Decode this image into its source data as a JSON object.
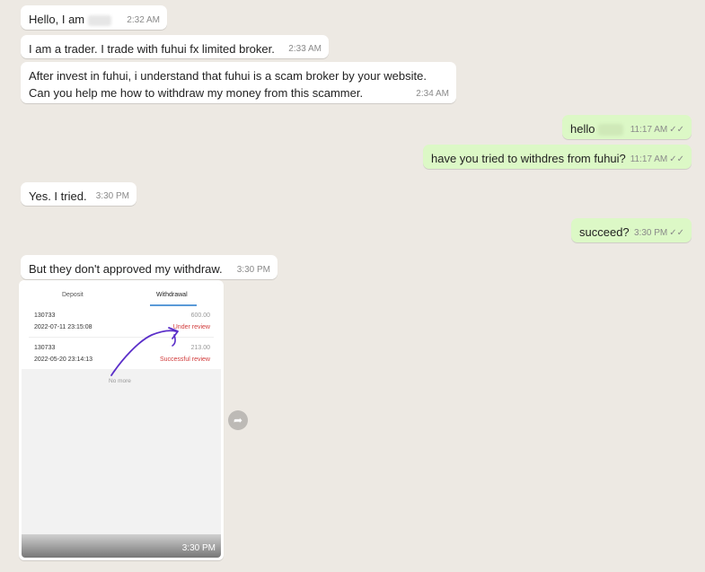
{
  "messages": [
    {
      "id": "m1",
      "text": "Hello, I am",
      "time": "2:32 AM"
    },
    {
      "id": "m2",
      "text": "I am a trader. I trade with  fuhui fx limited broker.",
      "time": "2:33 AM"
    },
    {
      "id": "m3",
      "text": "After invest in fuhui, i understand that fuhui is a scam broker by your website. Can you help me how to withdraw my money from this scammer.",
      "time": "2:34 AM"
    },
    {
      "id": "m4",
      "text": "hello",
      "time": "11:17 AM"
    },
    {
      "id": "m5",
      "text": "have you tried to withdres from fuhui?",
      "time": "11:17 AM"
    },
    {
      "id": "m6",
      "text": "Yes. I tried.",
      "time": "3:30 PM"
    },
    {
      "id": "m7",
      "text": "succeed?",
      "time": "3:30 PM"
    },
    {
      "id": "m8",
      "text": "But they don't approved my withdraw.",
      "time": "3:30 PM"
    }
  ],
  "image_message": {
    "time": "3:30 PM",
    "tabs": [
      "Deposit",
      "Withdrawal"
    ],
    "rows": [
      {
        "id": "130733",
        "date": "2022-07-11 23:15:08",
        "amount": "600.00",
        "status": "Under review"
      },
      {
        "id": "130733",
        "date": "2022-05-20 23:14:13",
        "amount": "213.00",
        "status": "Successful review"
      }
    ],
    "footer": "No more"
  },
  "icons": {
    "read_ticks": "double-check-icon",
    "forward": "forward-arrow-icon"
  },
  "colors": {
    "incoming": "#ffffff",
    "outgoing": "#dcf8c6",
    "background": "#ede9e3",
    "status_red": "#d13b3b",
    "annotation": "#5b2fc9"
  }
}
